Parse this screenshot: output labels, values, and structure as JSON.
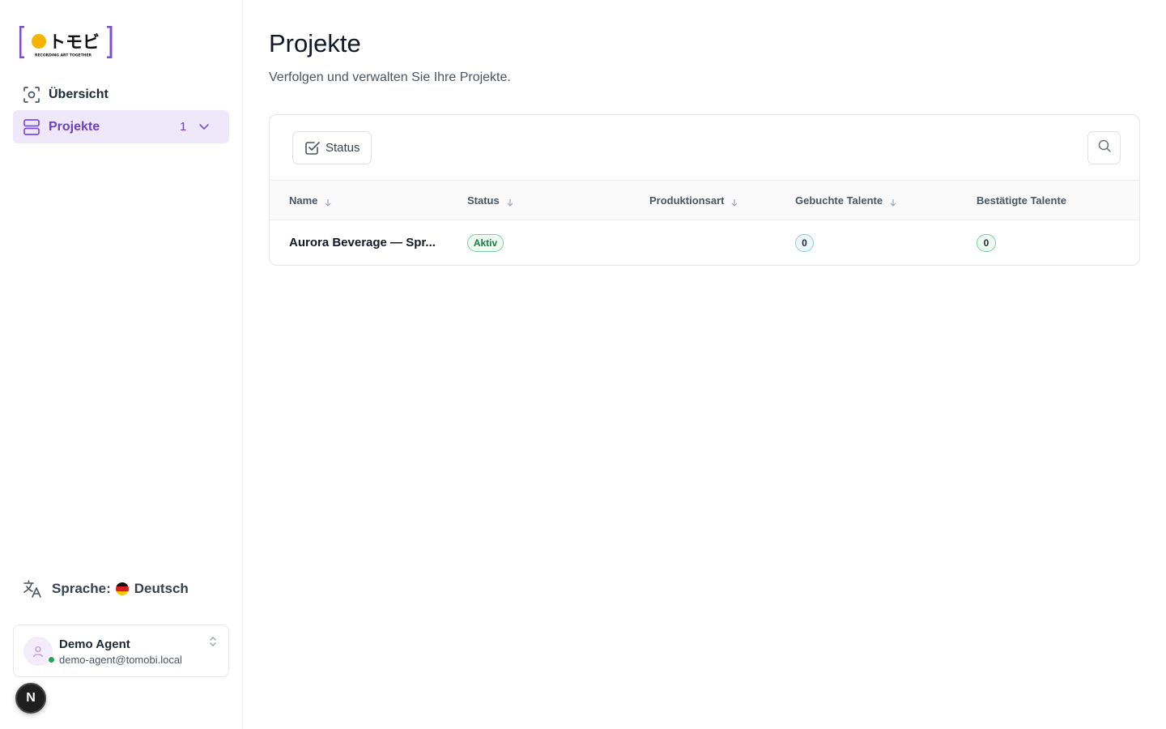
{
  "brand": {
    "logo_text": "トモビ",
    "tagline": "RECORDING ART TOGETHER",
    "accent": "#7c4dd6",
    "dot_color": "#f5b400"
  },
  "sidebar": {
    "items": [
      {
        "label": "Übersicht",
        "icon": "scan-eye-icon",
        "active": false
      },
      {
        "label": "Projekte",
        "icon": "server-stack-icon",
        "active": true,
        "count": "1"
      }
    ],
    "language": {
      "label": "Sprache:",
      "value": "Deutsch",
      "icon": "translate-icon",
      "flag": "german-flag-icon"
    },
    "user": {
      "name": "Demo Agent",
      "email": "demo-agent@tomobi.local",
      "status": "online"
    },
    "dev_badge": "N"
  },
  "main": {
    "title": "Projekte",
    "subtitle": "Verfolgen und verwalten Sie Ihre Projekte.",
    "toolbar": {
      "status_filter_label": "Status"
    },
    "table": {
      "columns": [
        "Name",
        "Status",
        "Produktionsart",
        "Gebuchte Talente",
        "Bestätigte Talente"
      ],
      "rows": [
        {
          "name": "Aurora Beverage — Spr...",
          "status": "Aktiv",
          "production_type": "",
          "booked_talents": "0",
          "confirmed_talents": "0"
        }
      ]
    }
  }
}
